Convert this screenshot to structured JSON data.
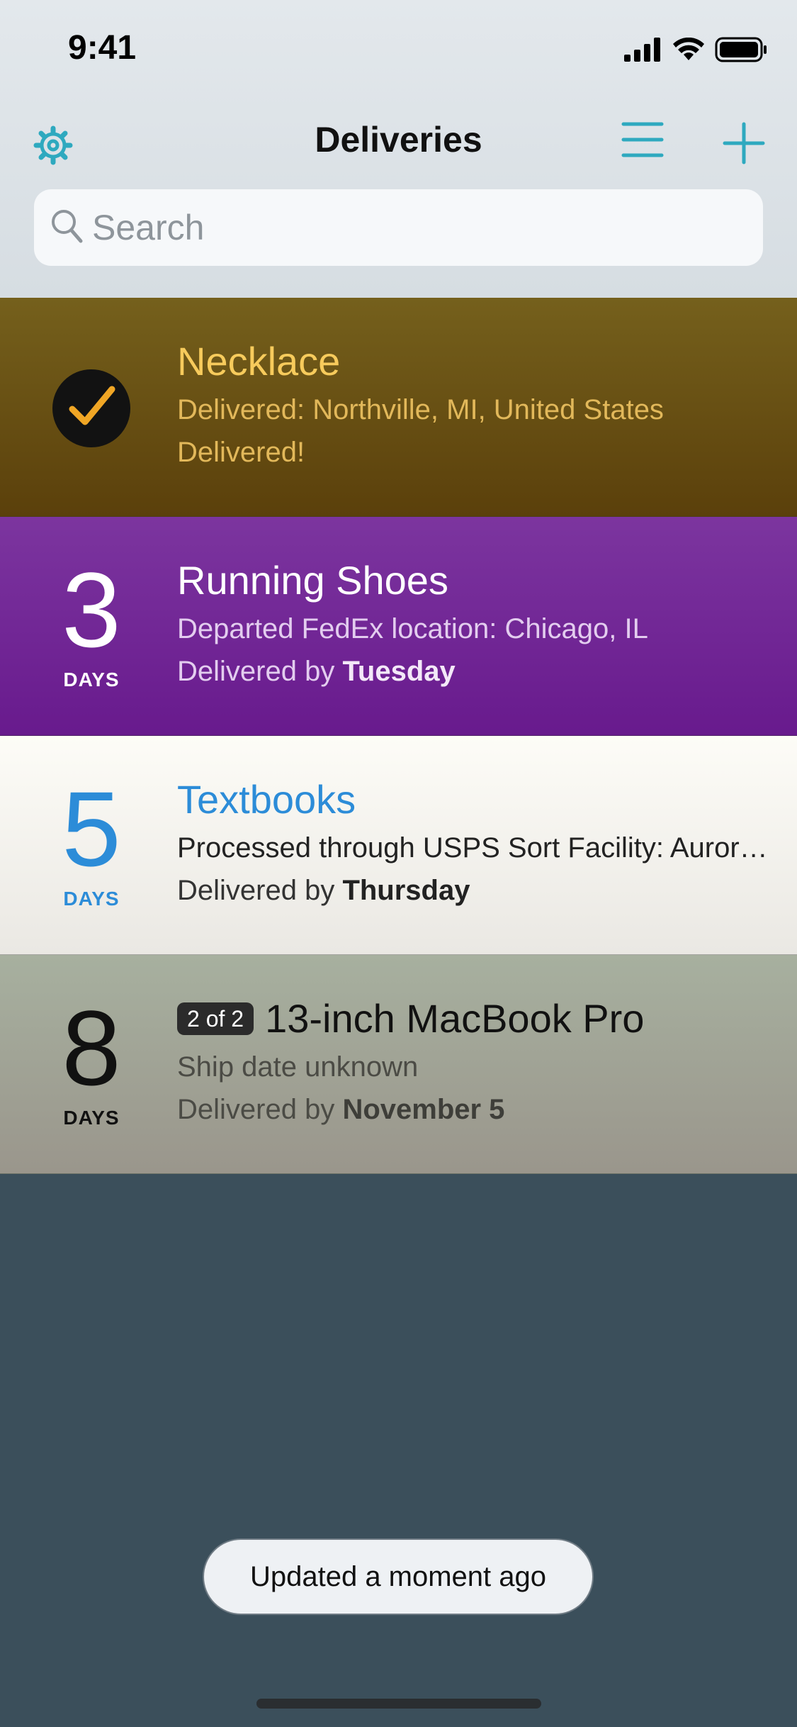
{
  "status_bar": {
    "time": "9:41"
  },
  "nav": {
    "title": "Deliveries",
    "settings_icon": "gear-icon",
    "menu_icon": "hamburger-icon",
    "add_icon": "plus-icon",
    "accent_color": "#2ea9bf"
  },
  "search": {
    "placeholder": "Search",
    "value": ""
  },
  "deliveries": [
    {
      "status": "delivered",
      "title": "Necklace",
      "detail": "Delivered: Northville, MI, United States",
      "eta_text": "Delivered!",
      "color": "#6a501a"
    },
    {
      "days": "3",
      "days_label": "DAYS",
      "title": "Running Shoes",
      "detail": "Departed FedEx location: Chicago, IL",
      "eta_prefix": "Delivered by ",
      "eta_day": "Tuesday",
      "color": "#72279a"
    },
    {
      "days": "5",
      "days_label": "DAYS",
      "title": "Textbooks",
      "detail": "Processed through USPS Sort Facility: Aurora, IL",
      "eta_prefix": "Delivered by ",
      "eta_day": "Thursday",
      "color": "#f4f2ec",
      "accent": "#2c8cd8"
    },
    {
      "days": "8",
      "days_label": "DAYS",
      "badge": "2 of 2",
      "title": "13-inch MacBook Pro",
      "detail": "Ship date unknown",
      "eta_prefix": "Delivered by ",
      "eta_day": "November 5",
      "color": "#a1a396"
    }
  ],
  "toast": {
    "text": "Updated a moment ago"
  }
}
